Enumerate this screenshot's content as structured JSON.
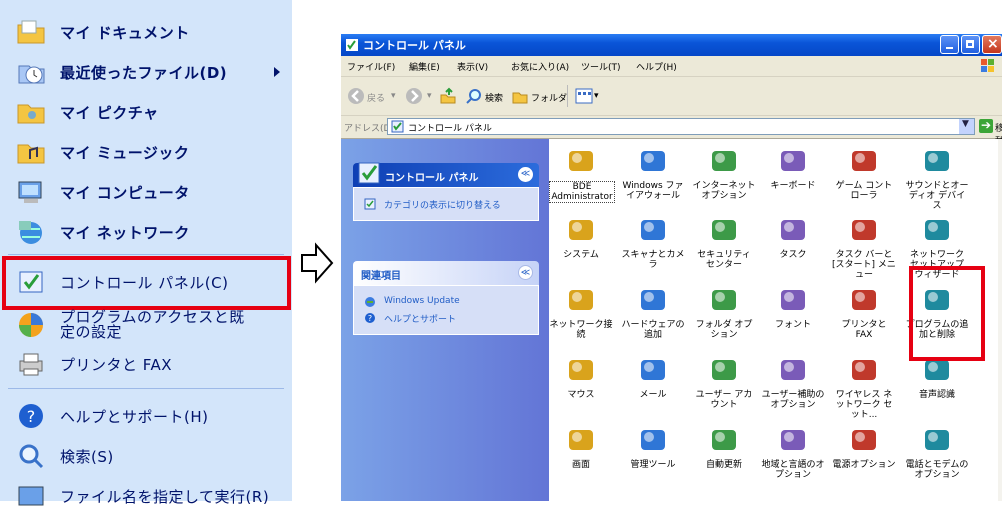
{
  "start_menu": {
    "items": [
      {
        "label": "マイ ドキュメント",
        "icon": "folder-documents-icon",
        "bold": true
      },
      {
        "label": "最近使ったファイル(D)",
        "icon": "recent-documents-icon",
        "bold": true
      },
      {
        "label": "マイ ピクチャ",
        "icon": "folder-pictures-icon",
        "bold": true
      },
      {
        "label": "マイ ミュージック",
        "icon": "folder-music-icon",
        "bold": true
      },
      {
        "label": "マイ コンピュータ",
        "icon": "computer-icon",
        "bold": true
      },
      {
        "label": "マイ ネットワーク",
        "icon": "network-icon",
        "bold": true
      },
      {
        "label": "コントロール パネル(C)",
        "icon": "control-panel-icon",
        "bold": false
      },
      {
        "label": "プログラムのアクセスと既定の設定",
        "icon": "program-access-icon",
        "bold": false
      },
      {
        "label": "プリンタと FAX",
        "icon": "printer-icon",
        "bold": false
      },
      {
        "label": "ヘルプとサポート(H)",
        "icon": "help-icon",
        "bold": false
      },
      {
        "label": "検索(S)",
        "icon": "search-icon",
        "bold": false
      },
      {
        "label": "ファイル名を指定して実行(R)",
        "icon": "run-icon",
        "bold": false
      }
    ],
    "highlight_color": "#e60012"
  },
  "window": {
    "title": "コントロール パネル",
    "menu": [
      "ファイル(F)",
      "編集(E)",
      "表示(V)",
      "お気に入り(A)",
      "ツール(T)",
      "ヘルプ(H)"
    ],
    "toolbar": {
      "back": "戻る",
      "search": "検索",
      "folders": "フォルダ"
    },
    "address_label": "アドレス(D)",
    "address_value": "コントロール パネル",
    "go_label": "移動",
    "left_pane": {
      "panel1_title": "コントロール パネル",
      "switch_link": "カテゴリの表示に切り替える",
      "panel2_title": "関連項目",
      "related": [
        "Windows Update",
        "ヘルプとサポート"
      ]
    },
    "icons": [
      [
        "BDE Administrator",
        "Windows ファイアウォール",
        "インターネット オプション",
        "キーボード",
        "ゲーム コントローラ",
        "サウンドとオーディオ デバイス"
      ],
      [
        "システム",
        "スキャナとカメラ",
        "セキュリティ センター",
        "タスク",
        "タスク バーと [スタート] メニュー",
        "ネットワーク セットアップ ウィザード"
      ],
      [
        "ネットワーク接続",
        "ハードウェアの追加",
        "フォルダ オプション",
        "フォント",
        "プリンタと FAX",
        "プログラムの追加と削除"
      ],
      [
        "マウス",
        "メール",
        "ユーザー アカウント",
        "ユーザー補助のオプション",
        "ワイヤレス ネットワーク セット...",
        "音声認識"
      ],
      [
        "画面",
        "管理ツール",
        "自動更新",
        "地域と言語のオプション",
        "電源オプション",
        "電話とモデムのオプション"
      ]
    ],
    "icon_names": [
      [
        "bde-admin-icon",
        "firewall-icon",
        "internet-options-icon",
        "keyboard-icon",
        "game-controller-icon",
        "sound-icon"
      ],
      [
        "system-icon",
        "scanner-camera-icon",
        "security-center-icon",
        "tasks-icon",
        "taskbar-icon",
        "network-setup-icon"
      ],
      [
        "network-connections-icon",
        "add-hardware-icon",
        "folder-options-icon",
        "fonts-icon",
        "printers-fax-icon",
        "add-remove-programs-icon"
      ],
      [
        "mouse-icon",
        "mail-icon",
        "user-accounts-icon",
        "accessibility-icon",
        "wireless-network-icon",
        "speech-icon"
      ],
      [
        "display-icon",
        "admin-tools-icon",
        "auto-update-icon",
        "regional-language-icon",
        "power-options-icon",
        "phone-modem-icon"
      ]
    ]
  }
}
